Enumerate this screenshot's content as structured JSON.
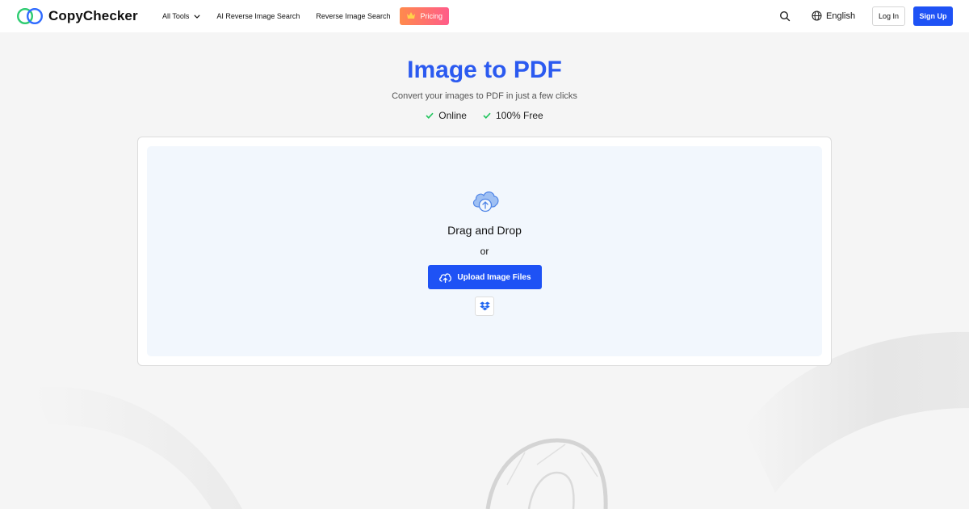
{
  "header": {
    "brand": "CopyChecker",
    "nav": [
      {
        "label": "All Tools",
        "has_dropdown": true
      },
      {
        "label": "AI Reverse Image Search"
      },
      {
        "label": "Reverse Image Search"
      }
    ],
    "pricing_label": "Pricing",
    "language": "English",
    "login_label": "Log In",
    "signup_label": "Sign Up"
  },
  "hero": {
    "title": "Image to PDF",
    "subtitle": "Convert your images to PDF in just a few clicks",
    "features": [
      "Online",
      "100% Free"
    ]
  },
  "upload": {
    "drag_text": "Drag and Drop",
    "or_text": "or",
    "button_label": "Upload Image Files"
  },
  "colors": {
    "accent_blue": "#1e52f5",
    "title_blue": "#2b5af0",
    "check_green": "#22c55e",
    "pricing_gradient_start": "#ff8a4c",
    "pricing_gradient_end": "#ff5c8a",
    "dropzone_bg": "#f2f7fd",
    "page_bg": "#f5f5f5"
  },
  "icons": {
    "logo": "two-rings-logo-icon",
    "dropdown": "chevron-down-icon",
    "pricing": "crown-icon",
    "search": "search-icon",
    "language": "globe-icon",
    "feature_check": "check-icon",
    "dropzone": "cloud-upload-icon",
    "upload_button": "cloud-upload-icon",
    "dropbox": "dropbox-icon"
  }
}
